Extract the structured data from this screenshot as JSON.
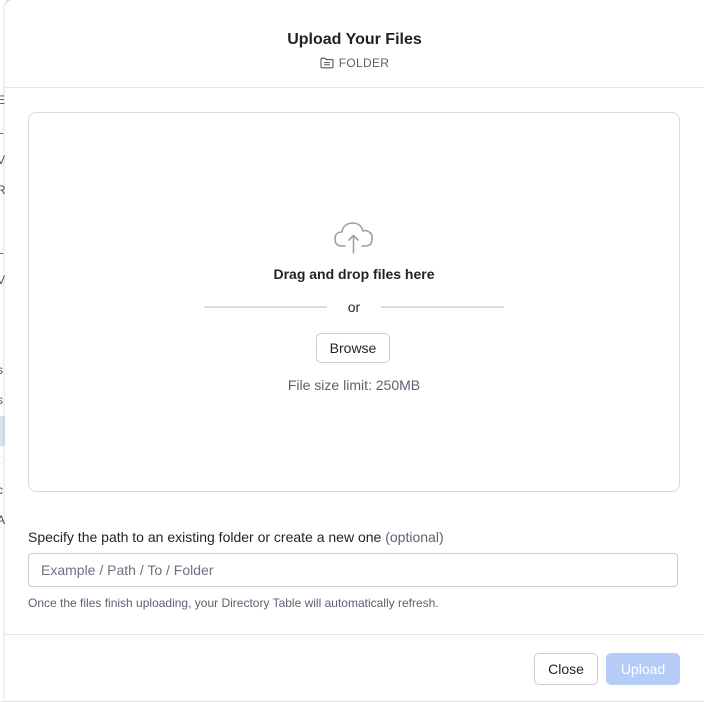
{
  "modal": {
    "title": "Upload Your Files",
    "subtitle": "FOLDER",
    "subtitle_icon": "folder-icon"
  },
  "dropzone": {
    "icon": "cloud-upload-icon",
    "title": "Drag and drop files here",
    "or_text": "or",
    "browse_label": "Browse",
    "limit_text": "File size limit: 250MB"
  },
  "path": {
    "label": "Specify the path to an existing folder or create a new one",
    "optional_label": "(optional)",
    "placeholder": "Example / Path / To / Folder",
    "value": "",
    "hint": "Once the files finish uploading, your Directory Table will automatically refresh."
  },
  "footer": {
    "close_label": "Close",
    "upload_label": "Upload",
    "upload_disabled": true
  },
  "colors": {
    "upload_disabled_bg": "#b5ccf7",
    "divider": "#d9dbe7",
    "border": "#d7dade"
  },
  "background_page": {
    "partial_chars": [
      "E",
      "L",
      "V",
      "R",
      "L",
      "V",
      "s",
      "s",
      "I",
      "t",
      "c",
      "A"
    ]
  }
}
